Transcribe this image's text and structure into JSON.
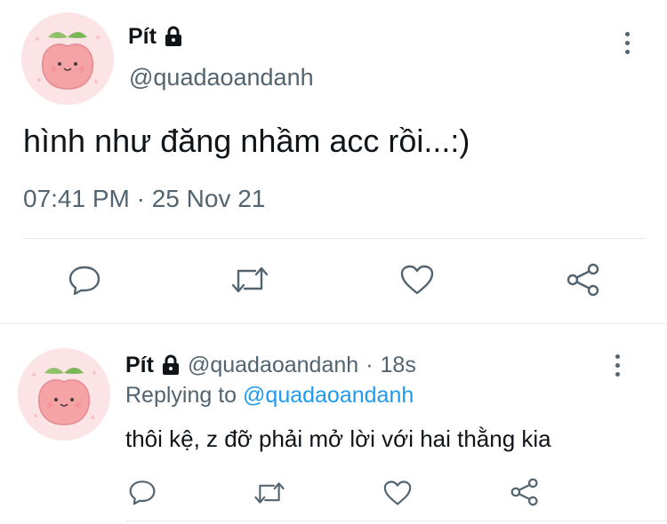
{
  "main_tweet": {
    "display_name": "Pít",
    "handle": "@quadaoandanh",
    "text": "hình như đăng nhầm acc rồi...:)",
    "timestamp": "07:41 PM · 25 Nov 21",
    "icons": [
      "lock-icon",
      "more-icon",
      "reply-icon",
      "retweet-icon",
      "like-icon",
      "share-icon"
    ]
  },
  "reply_tweet": {
    "display_name": "Pít",
    "handle": "@quadaoandanh",
    "separator": "·",
    "time_ago": "18s",
    "replying_prefix": "Replying to",
    "replying_handle": "@quadaoandanh",
    "text": "thôi kệ, z đỡ phải mở lời với hai thằng kia",
    "icons": [
      "lock-icon",
      "more-icon",
      "reply-icon",
      "retweet-icon",
      "like-icon",
      "share-icon"
    ]
  },
  "colors": {
    "icon_gray": "#536471",
    "link_blue": "#1d9bf0",
    "divider": "#e6e9ec",
    "avatar_bg": "#fbe3e6",
    "peach": "#f6a3a6"
  }
}
